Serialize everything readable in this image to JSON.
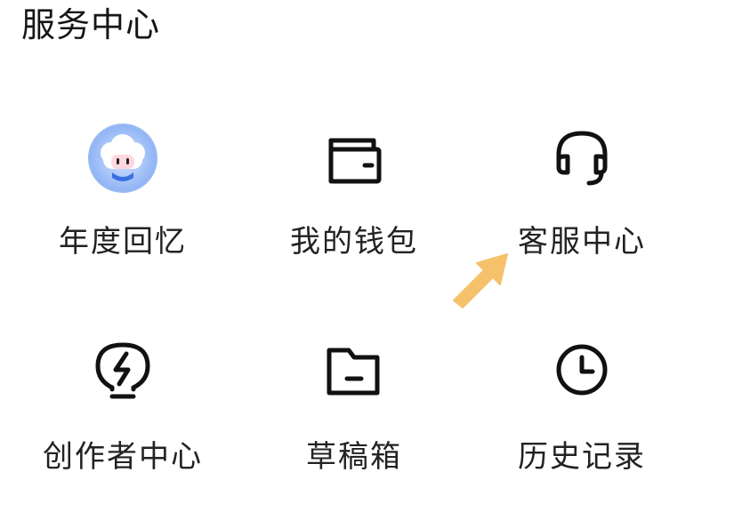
{
  "section": {
    "title": "服务中心"
  },
  "items": [
    {
      "label": "年度回忆",
      "icon": "mascot-avatar-icon"
    },
    {
      "label": "我的钱包",
      "icon": "wallet-icon"
    },
    {
      "label": "客服中心",
      "icon": "headset-icon"
    },
    {
      "label": "创作者中心",
      "icon": "lightning-bulb-icon"
    },
    {
      "label": "草稿箱",
      "icon": "folder-icon"
    },
    {
      "label": "历史记录",
      "icon": "clock-icon"
    }
  ],
  "colors": {
    "text": "#222222",
    "icon_stroke": "#111111",
    "avatar_ring": "#8fb3f5",
    "arrow": "#f5c26b"
  }
}
